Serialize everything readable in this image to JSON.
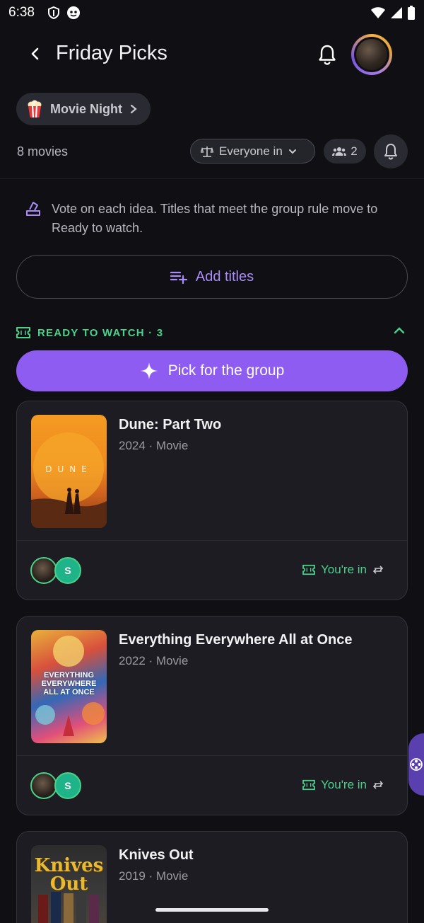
{
  "status_bar": {
    "time": "6:38"
  },
  "header": {
    "title": "Friday Picks"
  },
  "group_chip": {
    "label": "Movie Night"
  },
  "summary": {
    "movies_count": "8 movies",
    "rule": "Everyone in",
    "members": "2"
  },
  "info": {
    "text": "Vote on each idea. Titles that meet the group rule move to Ready to watch."
  },
  "add_button": {
    "label": "Add titles"
  },
  "section": {
    "title": "READY TO WATCH · 3"
  },
  "pick_button": {
    "label": "Pick for the group"
  },
  "cards": [
    {
      "title": "Dune: Part Two",
      "meta": "2024 · Movie",
      "poster_text": "DUNE",
      "voter_initial": "S",
      "status": "You're in"
    },
    {
      "title": "Everything Everywhere All at Once",
      "meta": "2022 · Movie",
      "poster_text": "EVERYTHING EVERYWHERE ALL AT ONCE",
      "voter_initial": "S",
      "status": "You're in"
    },
    {
      "title": "Knives Out",
      "meta": "2019 · Movie",
      "poster_text": "Knives Out"
    }
  ],
  "colors": {
    "accent": "#8e5cf0",
    "success": "#4cd18a",
    "background": "#0f0f14",
    "card": "#1c1c22"
  }
}
